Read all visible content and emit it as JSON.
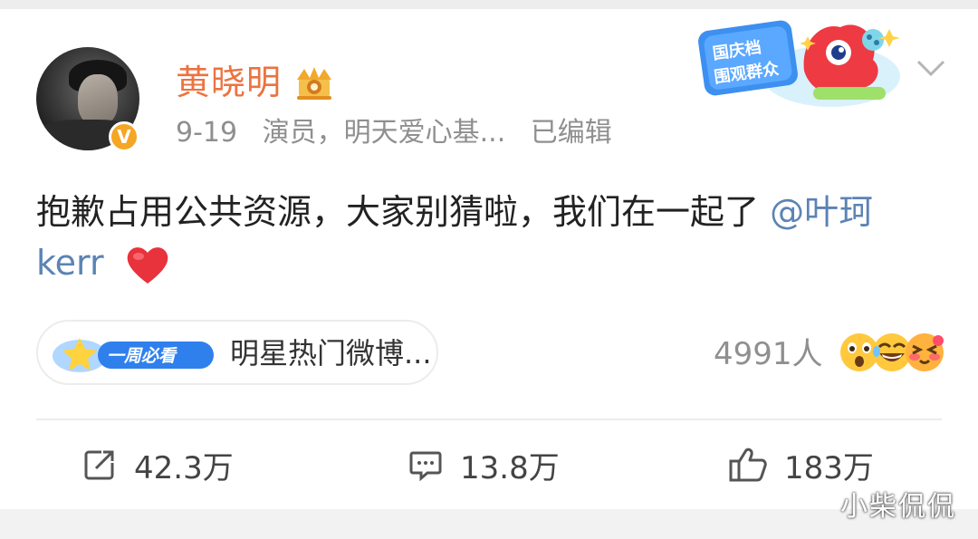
{
  "post": {
    "username": "黄晓明",
    "date": "9-19",
    "source": "演员，明天爱心基...",
    "edited": "已编辑",
    "text": "抱歉占用公共资源，大家别猜啦，我们在一起了 ",
    "mention": "@叶珂 kerr"
  },
  "sticker": {
    "line1": "国庆档",
    "line2": "围观群众"
  },
  "hot": {
    "badge_label": "一周必看",
    "label": "明星热门微博..."
  },
  "reactions": {
    "count": "4991人"
  },
  "actions": {
    "repost": "42.3万",
    "comment": "13.8万",
    "like": "183万"
  },
  "watermark": "小柴侃侃",
  "icons": {
    "verified": "verified-v-icon",
    "crown": "crown-icon",
    "menu": "chevron-down-icon",
    "heart": "heart-icon",
    "repost": "repost-icon",
    "comment": "comment-icon",
    "like": "thumbs-up-icon"
  },
  "colors": {
    "username": "#eb7340",
    "mention": "#5c83b4",
    "meta": "#8f8f8f",
    "heart": "#e8323c",
    "verified": "#f5a623"
  }
}
